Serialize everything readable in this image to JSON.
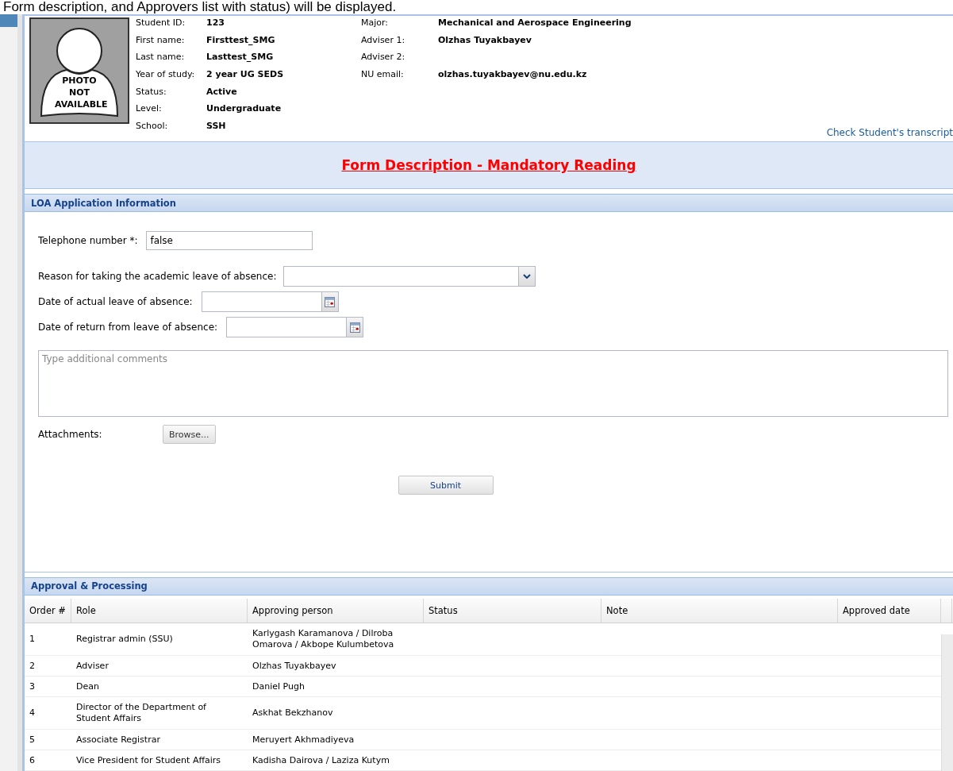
{
  "caption": "Form description, and Approvers list with status) will be displayed.",
  "student": {
    "photo_text": "PHOTO NOT AVAILABLE",
    "fields_left": [
      {
        "label": "Student ID:",
        "value": "123"
      },
      {
        "label": "First name:",
        "value": "Firsttest_SMG"
      },
      {
        "label": "Last name:",
        "value": "Lasttest_SMG"
      },
      {
        "label": "Year of study:",
        "value": "2 year UG SEDS"
      },
      {
        "label": "Status:",
        "value": "Active"
      },
      {
        "label": "Level:",
        "value": "Undergraduate"
      },
      {
        "label": "School:",
        "value": "SSH"
      }
    ],
    "fields_right": [
      {
        "label": "Major:",
        "value": "Mechanical and Aerospace Engineering"
      },
      {
        "label": "Adviser 1:",
        "value": "Olzhas Tuyakbayev"
      },
      {
        "label": "Adviser 2:"
      },
      {
        "label": "NU email:",
        "value": "olzhas.tuyakbayev@nu.edu.kz"
      }
    ],
    "transcript_link": "Check Student's transcript"
  },
  "form_description_link": "Form Description - Mandatory Reading",
  "loa_section": {
    "title": "LOA Application Information",
    "telephone": {
      "label": "Telephone number *:",
      "value": "false"
    },
    "reason": {
      "label": "Reason for taking the academic leave of absence:"
    },
    "leave_date": {
      "label": "Date of actual leave of absence:"
    },
    "return_date": {
      "label": "Date of return from leave of absence:"
    },
    "comments": {
      "placeholder": "Type additional comments"
    },
    "attachments": {
      "label": "Attachments:",
      "button": "Browse..."
    },
    "submit_button": "Submit"
  },
  "approval": {
    "title": "Approval & Processing",
    "columns": [
      "Order #",
      "Role",
      "Approving person",
      "Status",
      "Note",
      "Approved date"
    ],
    "rows": [
      [
        "1",
        "Registrar admin (SSU)",
        "Karlygash Karamanova / Dilroba Omarova / Akbope Kulumbetova"
      ],
      [
        "2",
        "Adviser",
        "Olzhas Tuyakbayev"
      ],
      [
        "3",
        "Dean",
        "Daniel Pugh"
      ],
      [
        "4",
        "Director of the Department of Student Affairs",
        "Askhat Bekzhanov"
      ],
      [
        "5",
        "Associate Registrar",
        "Meruyert Akhmadiyeva"
      ],
      [
        "6",
        "Vice President for Student Affairs",
        "Kadisha Dairova / Laziza Kutym"
      ]
    ]
  }
}
